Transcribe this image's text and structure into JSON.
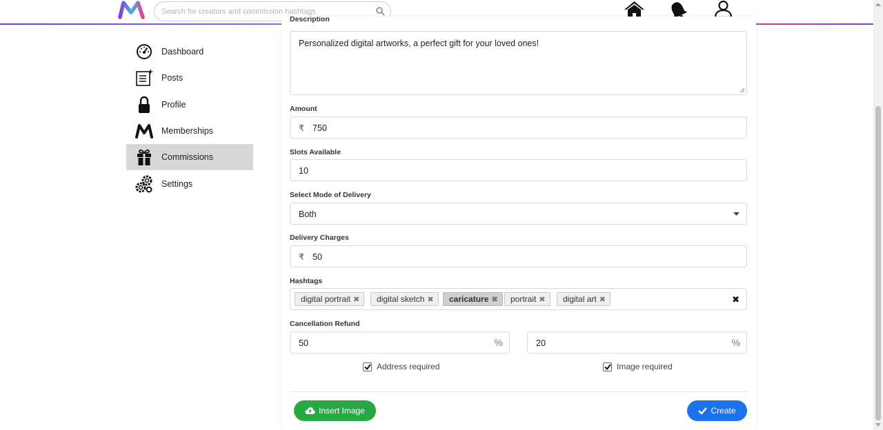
{
  "header": {
    "search_placeholder": "Search for creators and commission hashtags",
    "nav_icons": [
      "home-icon",
      "bell-icon",
      "user-icon"
    ]
  },
  "sidebar": {
    "items": [
      {
        "label": "Dashboard",
        "icon": "speedometer-icon"
      },
      {
        "label": "Posts",
        "icon": "posts-icon"
      },
      {
        "label": "Profile",
        "icon": "lock-icon"
      },
      {
        "label": "Memberships",
        "icon": "m-logo-icon"
      },
      {
        "label": "Commissions",
        "icon": "gift-icon",
        "active": true
      },
      {
        "label": "Settings",
        "icon": "gears-icon"
      }
    ]
  },
  "form": {
    "description_label": "Description",
    "description_value": "Personalized digital artworks, a perfect gift for your loved ones!",
    "amount_label": "Amount",
    "currency": "₹",
    "amount_value": "750",
    "slots_label": "Slots Available",
    "slots_value": "10",
    "delivery_mode_label": "Select Mode of Delivery",
    "delivery_mode_value": "Both",
    "delivery_charges_label": "Delivery Charges",
    "delivery_charges_value": "50",
    "hashtags_label": "Hashtags",
    "hashtags": [
      "digital portrait",
      "digital sketch",
      "caricature",
      "portrait",
      "digital art"
    ],
    "cancellation_label": "Cancellation Refund",
    "refund_1": "50",
    "refund_2": "20",
    "percent": "%",
    "address_required_label": "Address required",
    "address_required": true,
    "image_required_label": "Image required",
    "image_required": true,
    "insert_image_label": "Insert Image",
    "create_label": "Create"
  },
  "colors": {
    "insert_button": "#28a745",
    "create_button": "#1a73e8",
    "active_sidebar": "#d7d7d7"
  }
}
